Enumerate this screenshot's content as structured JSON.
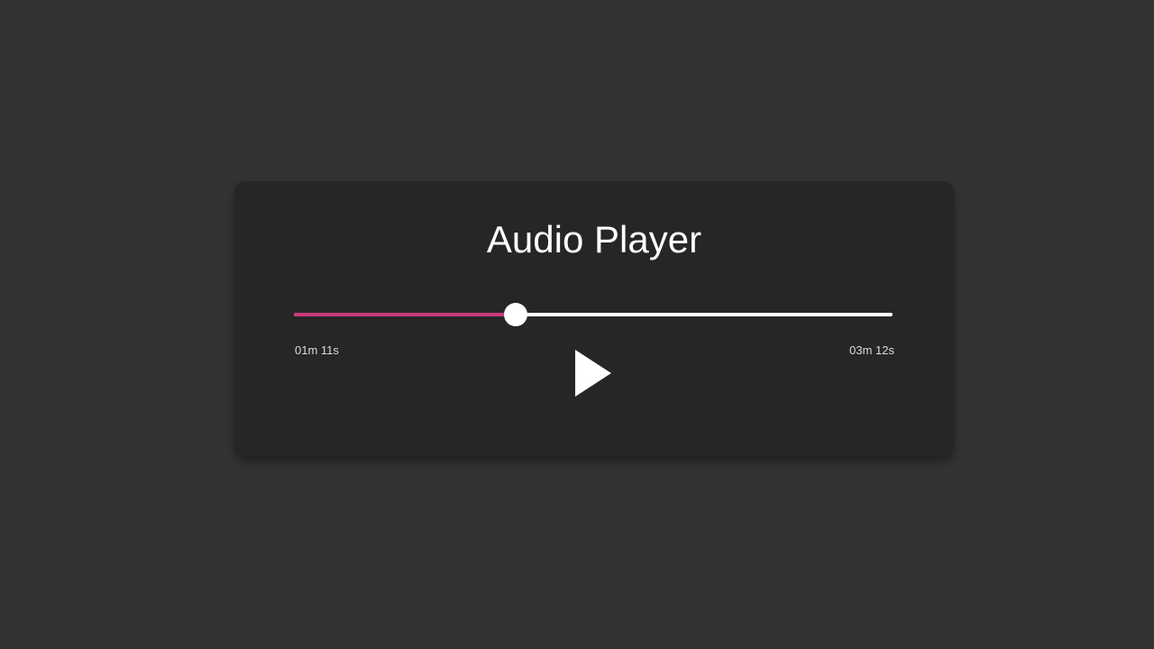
{
  "player": {
    "title": "Audio Player",
    "current_time": "01m 11s",
    "total_time": "03m 12s",
    "progress": 0.3698,
    "accent_color": "#c8387a",
    "play_icon": "play-icon"
  }
}
